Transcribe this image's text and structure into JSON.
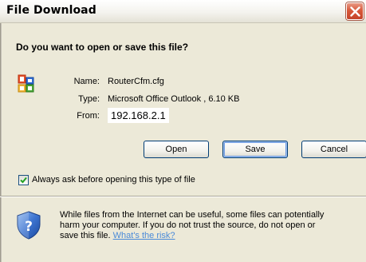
{
  "window": {
    "title": "File Download"
  },
  "dialog": {
    "question": "Do you want to open or save this file?",
    "name_label": "Name:",
    "name_value": "RouterCfm.cfg",
    "type_label": "Type:",
    "type_value": "Microsoft Office Outlook , 6.10 KB",
    "from_label": "From:",
    "from_value": "192.168.2.1"
  },
  "buttons": {
    "open": "Open",
    "save": "Save",
    "cancel": "Cancel"
  },
  "checkbox": {
    "label": "Always ask before opening this type of file",
    "checked": true
  },
  "warning": {
    "line1": "While files from the Internet can be useful, some files can potentially",
    "line2": "harm your computer. If you do not trust the source, do not open or",
    "line3_prefix": "save this file. ",
    "link": "What's the risk?"
  },
  "icons": {
    "file": "office-outlook-icon",
    "security": "shield-question-icon",
    "close": "close-icon",
    "check": "checkmark-icon"
  },
  "colors": {
    "dialog_bg": "#ece9d8",
    "close_button": "#d8583a",
    "link": "#4a8ad8",
    "button_border": "#003c74"
  }
}
